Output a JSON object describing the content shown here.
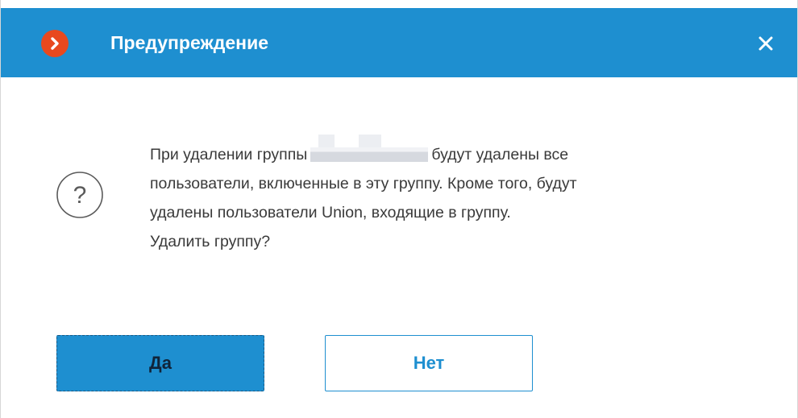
{
  "dialog": {
    "title": "Предупреждение",
    "header_color": "#1e8fd0",
    "logo_color": "#e8491f",
    "close_icon": "close-icon",
    "status_icon": "question-circle-icon",
    "message": {
      "line1_before": "При удалении группы",
      "line1_after": "будут удалены все",
      "line2": "пользователи, включенные в эту группу. Кроме того, будут",
      "line3": "удалены пользователи Union, входящие в группу.",
      "line4": "Удалить группу?"
    },
    "buttons": {
      "yes_label": "Да",
      "no_label": "Нет"
    }
  }
}
